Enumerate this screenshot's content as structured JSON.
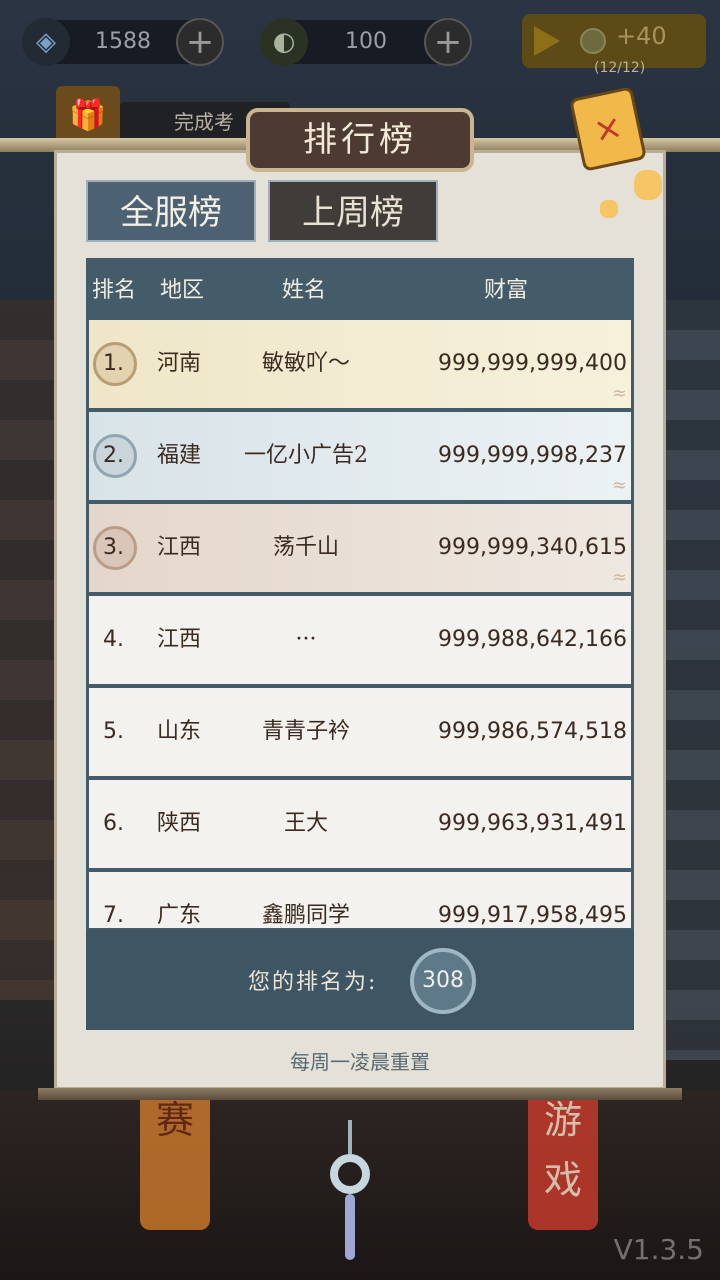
{
  "hud": {
    "currency1": {
      "icon": "water-drop-icon",
      "value": "1588"
    },
    "currency2": {
      "icon": "coin-icon",
      "value": "100"
    },
    "ad_reward": {
      "amount": "+40",
      "count": "(12/12)"
    }
  },
  "task": {
    "label": "完成考"
  },
  "panel": {
    "title": "排行榜",
    "tabs": [
      {
        "label": "全服榜",
        "active": true
      },
      {
        "label": "上周榜",
        "active": false
      }
    ],
    "headers": {
      "rank": "排名",
      "region": "地区",
      "name": "姓名",
      "wealth": "财富"
    },
    "rows": [
      {
        "rank": "1.",
        "region": "河南",
        "name": "敏敏吖～",
        "wealth": "999,999,999,400"
      },
      {
        "rank": "2.",
        "region": "福建",
        "name": "一亿小广告2",
        "wealth": "999,999,998,237"
      },
      {
        "rank": "3.",
        "region": "江西",
        "name": "荡千山",
        "wealth": "999,999,340,615"
      },
      {
        "rank": "4.",
        "region": "江西",
        "name": "···",
        "wealth": "999,988,642,166"
      },
      {
        "rank": "5.",
        "region": "山东",
        "name": "青青子衿",
        "wealth": "999,986,574,518"
      },
      {
        "rank": "6.",
        "region": "陕西",
        "name": "王大",
        "wealth": "999,963,931,491"
      },
      {
        "rank": "7.",
        "region": "广东",
        "name": "鑫鹏同学",
        "wealth": "999,917,958,495"
      }
    ],
    "my_rank_label": "您的排名为:",
    "my_rank_value": "308",
    "reset_note": "每周一凌晨重置"
  },
  "background": {
    "banner_left": "赛",
    "banner_right": "游戏"
  },
  "version": "V1.3.5"
}
